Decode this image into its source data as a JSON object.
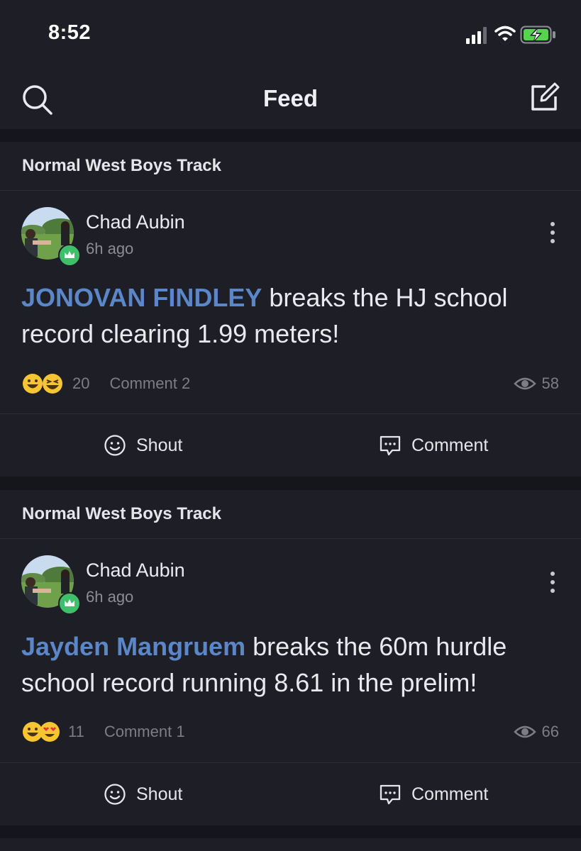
{
  "status_bar": {
    "time": "8:52",
    "icons": [
      "signal-icon",
      "wifi-icon",
      "battery-charging-icon"
    ]
  },
  "nav": {
    "title": "Feed",
    "left_icon": "search-icon",
    "right_icon": "compose-icon"
  },
  "posts": [
    {
      "group": "Normal West Boys Track",
      "author": "Chad Aubin",
      "time_ago": "6h ago",
      "mention": "JONOVAN FINDLEY",
      "text": " breaks the HJ school record clearing 1.99 meters!",
      "reactions": [
        "grinning-face",
        "laughing-face"
      ],
      "reaction_count": "20",
      "comment_label": "Comment 2",
      "views": "58",
      "actions": {
        "shout": "Shout",
        "comment": "Comment"
      }
    },
    {
      "group": "Normal West Boys Track",
      "author": "Chad Aubin",
      "time_ago": "6h ago",
      "mention": "Jayden Mangruem",
      "text": " breaks the 60m hurdle school record running 8.61 in the prelim!",
      "reactions": [
        "grinning-face",
        "heart-eyes-face"
      ],
      "reaction_count": "11",
      "comment_label": "Comment 1",
      "views": "66",
      "actions": {
        "shout": "Shout",
        "comment": "Comment"
      }
    }
  ],
  "colors": {
    "background": "#15161b",
    "card": "#1d1e26",
    "mention": "#5b86c8",
    "muted": "#7c7d86",
    "badge": "#3fbf6a"
  }
}
